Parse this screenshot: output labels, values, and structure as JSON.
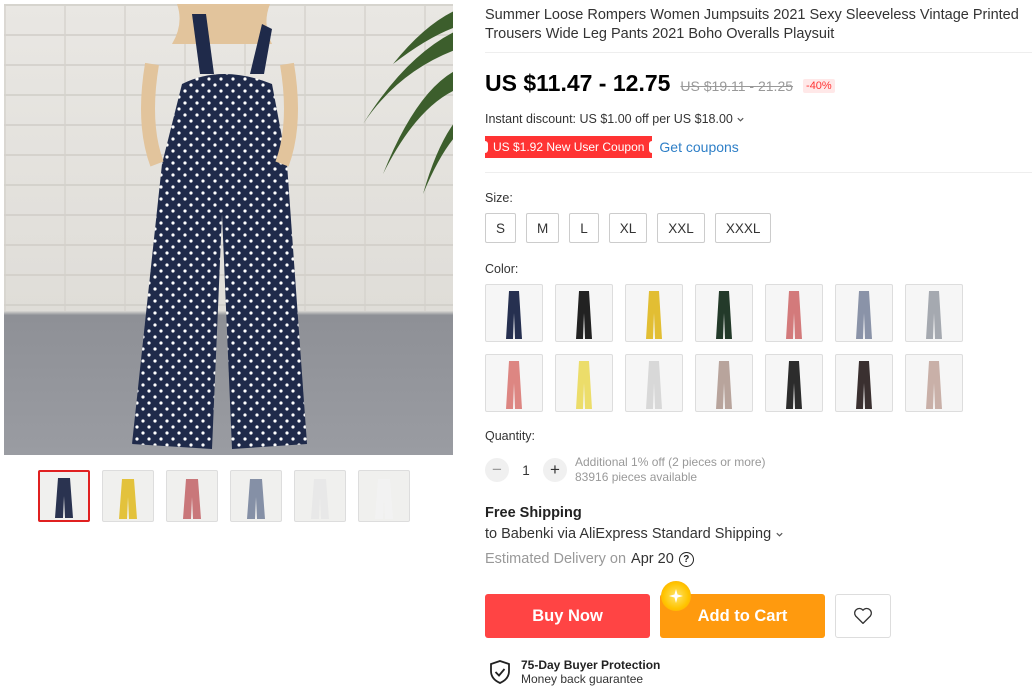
{
  "product": {
    "title": "Summer Loose Rompers Women Jumpsuits 2021 Sexy Sleeveless Vintage Printed Trousers Wide Leg Pants 2021 Boho Overalls Playsuit",
    "price": "US $11.47 - 12.75",
    "original_price": "US $19.11 - 21.25",
    "discount": "-40%",
    "instant_discount": "Instant discount: US $1.00 off per US $18.00",
    "coupon": "US $1.92 New User Coupon",
    "get_coupons": "Get coupons"
  },
  "gallery": {
    "thumbnails": [
      {
        "color": "#2a3350"
      },
      {
        "color": "#e3c23c"
      },
      {
        "color": "#c9777a"
      },
      {
        "color": "#8590a6"
      },
      {
        "color": "#e8e8e8"
      },
      {
        "color": "#f2f2f2"
      }
    ]
  },
  "size": {
    "label": "Size:",
    "options": [
      "S",
      "M",
      "L",
      "XL",
      "XXL",
      "XXXL"
    ]
  },
  "color": {
    "label": "Color:",
    "swatches": [
      "#263050",
      "#222222",
      "#e2be33",
      "#233a2a",
      "#d37a7b",
      "#8a93a8",
      "#a5a9b0",
      "#dd8682",
      "#ecdd6a",
      "#d8d8d8",
      "#b8a49c",
      "#2c2c2c",
      "#3a3030",
      "#c9b0a8"
    ]
  },
  "quantity": {
    "label": "Quantity:",
    "value": "1",
    "minus": "−",
    "plus": "+",
    "note_1": "Additional 1% off (2 pieces or more)",
    "note_2": "83916 pieces available"
  },
  "shipping": {
    "title": "Free Shipping",
    "line": "to Babenki via AliExpress Standard Shipping",
    "delivery_label": "Estimated Delivery on",
    "delivery_date": "Apr 20"
  },
  "actions": {
    "buy_now": "Buy Now",
    "add_to_cart": "Add to Cart"
  },
  "protection": {
    "title": "75-Day Buyer Protection",
    "subtitle": "Money back guarantee"
  }
}
